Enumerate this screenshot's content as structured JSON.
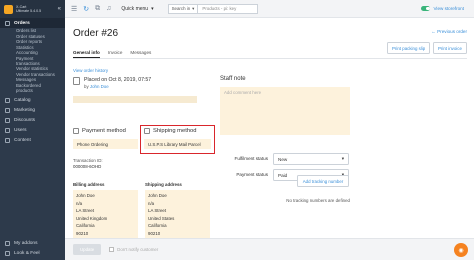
{
  "brand": {
    "line1": "X-Cart",
    "line2": "Ultimate 5.4.0.5"
  },
  "sidebar": {
    "orders": "Orders",
    "order_subitems": [
      "Orders list",
      "Order statuses",
      "Order reports",
      "Statistics",
      "Accounting",
      "Payment",
      "transactions",
      "Vendor statistics",
      "Vendor transactions",
      "Messages",
      "Backordered",
      "products"
    ],
    "items": [
      "Catalog",
      "Marketing",
      "Discounts",
      "Users",
      "Content"
    ],
    "bottom": [
      "My addons",
      "Look & Feel"
    ]
  },
  "topbar": {
    "quick_menu": "Quick menu",
    "search_scope": "Search in",
    "search_placeholder": "Products - pi: key",
    "storefront": "View storefront"
  },
  "order": {
    "title": "Order #26",
    "prev_link": "← Previous order",
    "tabs": [
      "General info",
      "Invoice",
      "Messages"
    ],
    "print_slip": "Print packing slip",
    "print_invoice": "Print invoice",
    "history_link": "View order history",
    "placed_on": "Placed on Oct 8, 2019, 07:57",
    "placed_by_prefix": "by",
    "placed_by": "John Doe"
  },
  "payment": {
    "title": "Payment method",
    "value": "Phone Ordering",
    "txid_label": "Transaction ID:",
    "txid_value": "000008-6OHD"
  },
  "shipping": {
    "title": "Shipping method",
    "value": "U.S.P.S Library Mail Parcel"
  },
  "billing": {
    "label": "Billing address",
    "lines": [
      "John Doe",
      "n/a",
      "LA Street",
      "United Kingdom",
      "California",
      "90210"
    ]
  },
  "shipping_address": {
    "label": "Shipping address",
    "lines": [
      "John Doe",
      "n/a",
      "LA Street",
      "United States",
      "California",
      "90210"
    ]
  },
  "staff": {
    "title": "Staff note",
    "placeholder": "Add comment here"
  },
  "status": {
    "fulfilment_label": "Fulfilment status",
    "fulfilment_value": "New",
    "payment_label": "Payment status",
    "payment_value": "Paid"
  },
  "tracking": {
    "button": "Add tracking number",
    "empty": "No tracking numbers are defined"
  },
  "footer": {
    "update": "Update",
    "notify": "Don't notify customer"
  }
}
